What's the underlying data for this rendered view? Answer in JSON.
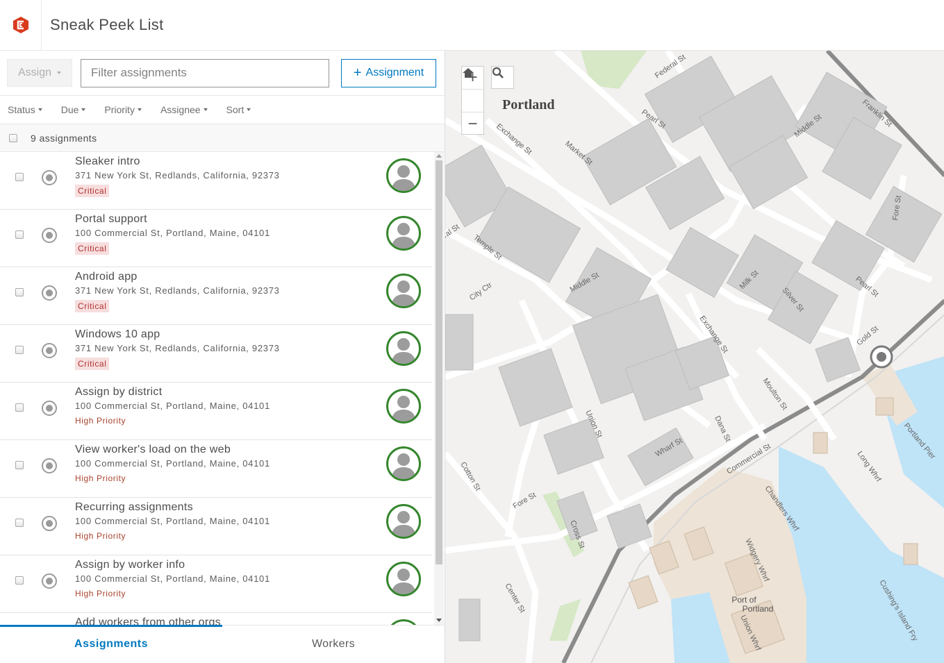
{
  "app": {
    "title": "Sneak Peek List",
    "logo_color": "#d83b1e"
  },
  "toolbar": {
    "assign_label": "Assign",
    "filter_placeholder": "Filter assignments",
    "add_label": "Assignment"
  },
  "sortbar": {
    "status": "Status",
    "due": "Due",
    "priority": "Priority",
    "assignee": "Assignee",
    "sort": "Sort"
  },
  "list": {
    "count": "9 assignments",
    "items": [
      {
        "title": "Sleaker intro",
        "address": "371 New York St, Redlands, California, 92373",
        "priority": "Critical"
      },
      {
        "title": "Portal support",
        "address": "100 Commercial St, Portland, Maine, 04101",
        "priority": "Critical"
      },
      {
        "title": "Android app",
        "address": "371 New York St, Redlands, California, 92373",
        "priority": "Critical"
      },
      {
        "title": "Windows 10 app",
        "address": "371 New York St, Redlands, California, 92373",
        "priority": "Critical"
      },
      {
        "title": "Assign by district",
        "address": "100 Commercial St, Portland, Maine, 04101",
        "priority": "High Priority"
      },
      {
        "title": "View worker's load on the web",
        "address": "100 Commercial St, Portland, Maine, 04101",
        "priority": "High Priority"
      },
      {
        "title": "Recurring assignments",
        "address": "100 Commercial St, Portland, Maine, 04101",
        "priority": "High Priority"
      },
      {
        "title": "Assign by worker info",
        "address": "100 Commercial St, Portland, Maine, 04101",
        "priority": "High Priority"
      },
      {
        "title": "Add workers from other orgs",
        "address": "",
        "priority": ""
      }
    ]
  },
  "tabs": {
    "assignments": "Assignments",
    "workers": "Workers"
  },
  "map": {
    "city_label": "Portland",
    "port_label_1": "Port of",
    "port_label_2": "Portland",
    "streets": {
      "federal": "Federal St",
      "pearl_top": "Pearl St",
      "exchange_top": "Exchange St",
      "market": "Market St",
      "franklin": "Franklin St",
      "middle_top": "Middle St",
      "fore_right": "Fore St",
      "temple": "Temple St",
      "city_ctr": "City Ctr",
      "middle_mid": "Middle St",
      "milk": "Milk St",
      "silver": "Silver St",
      "pearl_mid": "Pearl St",
      "exchange_mid": "Exchange St",
      "gold": "Gold St",
      "moulton": "Moulton St",
      "union": "Union St",
      "dana": "Dana St",
      "wharf": "Wharf St",
      "commercial": "Commercial St",
      "cotton": "Cotton St",
      "fore_low": "Fore St",
      "cross": "Cross St",
      "center": "Center St",
      "chandlers": "Chandlers Whrf",
      "widgery": "Widgery Whrf",
      "long": "Long Whrf",
      "portland_pier": "Portland Pier",
      "cushings": "Cushing's Island Fry",
      "union_whrf": "Union Whrf",
      "ral": "ral St"
    }
  },
  "colors": {
    "accent": "#0079c1",
    "avatar_ring": "#35862d",
    "critical": "#b03030",
    "high": "#a7432e",
    "water": "#bfe3f7"
  }
}
